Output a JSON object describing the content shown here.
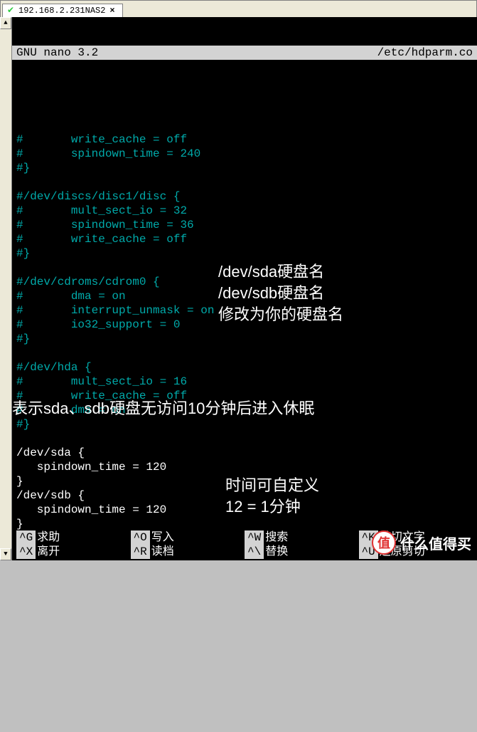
{
  "tab": {
    "title": "192.168.2.231NAS2"
  },
  "editor": {
    "name": "GNU nano 3.2",
    "filepath": "/etc/hdparm.co"
  },
  "file_lines": [
    "",
    "#       write_cache = off",
    "#       spindown_time = 240",
    "#}",
    "",
    "#/dev/discs/disc1/disc {",
    "#       mult_sect_io = 32",
    "#       spindown_time = 36",
    "#       write_cache = off",
    "#}",
    "",
    "#/dev/cdroms/cdrom0 {",
    "#       dma = on",
    "#       interrupt_unmask = on",
    "#       io32_support = 0",
    "#}",
    "",
    "#/dev/hda {",
    "#       mult_sect_io = 16",
    "#       write_cache = off",
    "#       dma = on",
    "#}",
    "",
    "/dev/sda {",
    "   spindown_time = 120",
    "}",
    "/dev/sdb {",
    "   spindown_time = 120",
    "}",
    "",
    "",
    ""
  ],
  "annotations": {
    "a1": "/dev/sda硬盘名",
    "a2": "/dev/sdb硬盘名",
    "a3": "修改为你的硬盘名",
    "a4": "表示sda、sdb硬盘无访问10分钟后进入休眠",
    "a5": "时间可自定义",
    "a6": "12 = 1分钟"
  },
  "menu": {
    "row1": [
      {
        "key": "^G",
        "label": "求助"
      },
      {
        "key": "^O",
        "label": "写入"
      },
      {
        "key": "^W",
        "label": "搜索"
      },
      {
        "key": "^K",
        "label": "剪切文字"
      }
    ],
    "row2": [
      {
        "key": "^X",
        "label": "离开"
      },
      {
        "key": "^R",
        "label": "读档"
      },
      {
        "key": "^\\",
        "label": "替换"
      },
      {
        "key": "^U",
        "label": "还原剪切"
      }
    ]
  },
  "watermark": {
    "badge": "值",
    "text": "什么值得买"
  }
}
